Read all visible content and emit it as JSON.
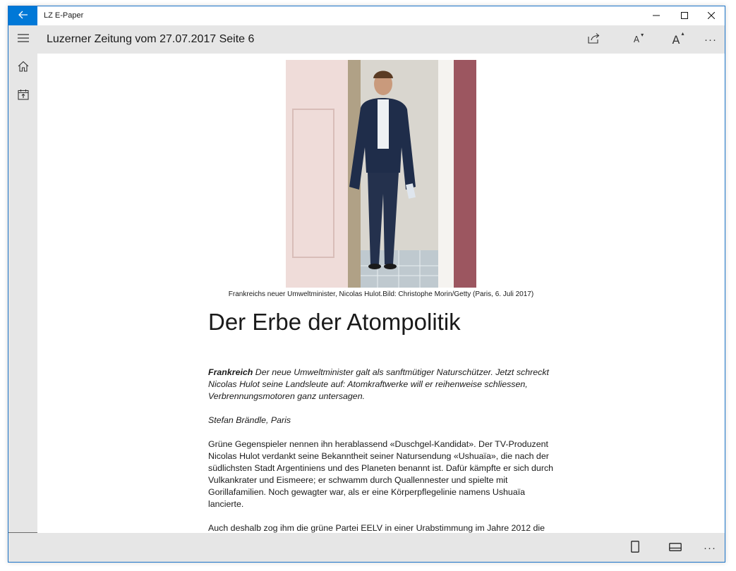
{
  "window": {
    "app_title": "LZ E-Paper",
    "accent_color": "#0078d7",
    "back_icon": "arrow-left-icon",
    "controls": [
      "minimize-icon",
      "maximize-icon",
      "close-icon"
    ]
  },
  "header": {
    "title": "Luzerner Zeitung vom 27.07.2017 Seite 6",
    "font_decrease_label": "A",
    "font_increase_label": "A",
    "more_label": "···",
    "icons": [
      "menu-icon",
      "share-icon",
      "font-decrease-icon",
      "font-increase-icon",
      "more-icon"
    ]
  },
  "sidebar": {
    "items": [
      {
        "icon": "home-icon"
      },
      {
        "icon": "calendar-icon"
      }
    ]
  },
  "article": {
    "photo_caption": "Frankreichs neuer Umweltminister, Nicolas Hulot.Bild: Christophe Morin/Getty (Paris, 6. Juli 2017)",
    "headline": "Der Erbe der Atompolitik",
    "lead_kicker": "Frankreich",
    "lead_text": " Der neue Umweltminister galt als sanftmütiger Naturschützer. Jetzt schreckt Nicolas Hulot seine Landsleute auf: Atomkraftwerke will er reihenweise schliessen, Verbrennungsmotoren ganz untersagen.",
    "author": "Stefan Brändle, Paris",
    "paragraphs": [
      "Grüne Gegenspieler nennen ihn herablassend «Duschgel-Kandidat». Der TV-Produzent Nicolas Hulot verdankt seine Bekanntheit seiner Natursendung «Ushuaïa», die nach der südlichsten Stadt Argentiniens und des Planeten benannt ist. Dafür kämpfte er sich durch Vulkankrater und Eismeere; er schwamm durch Quallennester und spielte mit Gorillafamilien. Noch gewagter war, als er eine Körperpflegelinie namens Ushuaïa lancierte.",
      "Auch deshalb zog ihm die grüne Partei EELV in einer Urabstimmung im Jahre 2012 die"
    ]
  },
  "bottombar": {
    "more_label": "···",
    "icons": [
      "single-page-icon",
      "double-page-icon",
      "more-icon"
    ]
  }
}
